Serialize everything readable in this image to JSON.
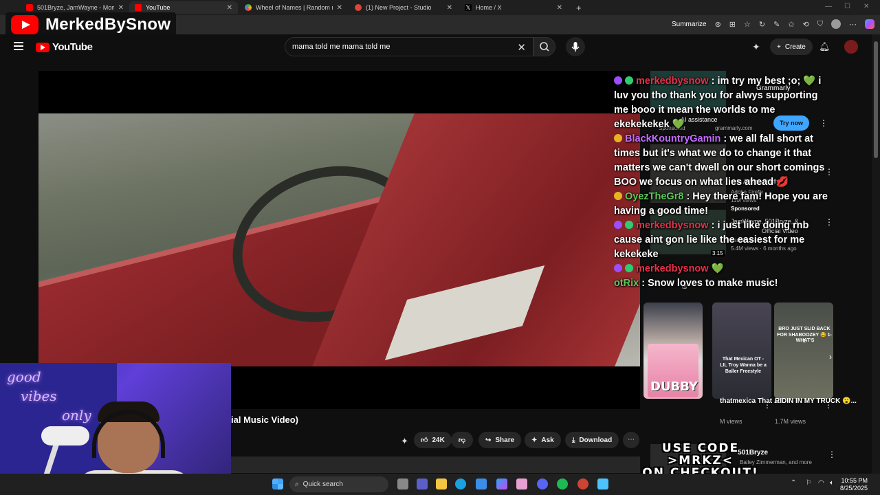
{
  "browser": {
    "tabs": [
      {
        "label": "501Bryze, JamWayne - Mom",
        "icon": "youtube-icon",
        "color": "#ff0000"
      },
      {
        "label": "YouTube",
        "icon": "youtube-icon",
        "color": "#ff0000"
      },
      {
        "label": "Wheel of Names | Random name",
        "icon": "wheel-icon",
        "color": "#34a853"
      },
      {
        "label": "(1) New Project - Studio",
        "icon": "studio-icon",
        "color": "#e0433a"
      },
      {
        "label": "Home / X",
        "icon": "x-icon",
        "color": "#ffffff"
      }
    ],
    "new_tab": "+",
    "summarize_label": "Summarize"
  },
  "overlay": {
    "channel_name": "MerkedBySnow",
    "code_line1": "USE CODE",
    "code_line2": ">MRKZ<",
    "code_line3": "ON CHECKOUT!"
  },
  "youtube": {
    "logo_text": "YouTube",
    "search_value": "mama told me mama told me",
    "create_label": "Create",
    "video_title_partial": "ial Music Video)",
    "actions": {
      "likes": "24K",
      "share": "Share",
      "ask": "Ask",
      "download": "Download"
    }
  },
  "sidebar": {
    "ad1": {
      "title": "Grammarly",
      "sub": "AI assistance",
      "sponsored": "Sponsored",
      "domain": "grammarly.com",
      "cta": "Try now"
    },
    "ad2": {
      "title": "with Adobe Firefly",
      "channel": "Adobe Firefly",
      "views": "11M views",
      "sponsored": "Sponsored"
    },
    "vid3": {
      "title": "JamWayne, 501Bryze, &",
      "channel": "JamWayne",
      "meta": "5.4M views · 6 months ago",
      "duration": "3:15",
      "tag": "Official Video"
    },
    "vid4_meta": "ts",
    "shorts": [
      {
        "title": "That Mexican OT - LIL Troy Wanna be a Baller Freestyle",
        "caption": "thatmexica That ...",
        "views": "M views"
      },
      {
        "title": "RIDIN IN MY TRUCK",
        "caption": "RIDIN IN MY TRUCK 😮...",
        "views": "1.7M views"
      }
    ],
    "shorts_captions": [
      "BRO JUST SLID BACK FOR SHABOOZEY 😂 1-1",
      "WHAT'S"
    ],
    "mix": {
      "title": "- 501Bryze",
      "sub": "Bailey Zimmerman, and more"
    }
  },
  "chat": [
    {
      "user": "merkedbysnow",
      "color": "#e8304a",
      "badges": [
        "mic",
        "check"
      ],
      "text": ": im try my best ;o; 💚 i luv you tho thank you for alwys supporting me booo it mean the worlds to me ekekekekek 💚"
    },
    {
      "user": "BlackKountryGamin",
      "color": "#c46dff",
      "badges": [
        "crown"
      ],
      "text": ": we all fall short at times but it's what we do to change it that matters we can't dwell on our short comings BOO we focus on what lies ahead 💋"
    },
    {
      "user": "OyezTheGr8",
      "color": "#5ac85a",
      "badges": [
        "crown"
      ],
      "text": ": Hey there fam! Hope you are having a good time!"
    },
    {
      "user": "merkedbysnow",
      "color": "#e8304a",
      "badges": [
        "mic",
        "check"
      ],
      "text": ": i just like doing rnb cause aint gon lie like the easiest for me kekekeke"
    },
    {
      "user": "merkedbysnow",
      "color": "#e8304a",
      "badges": [
        "mic",
        "check"
      ],
      "text": " 💚"
    },
    {
      "user": "otRix",
      "color": "#5ac85a",
      "badges": [],
      "text": ": Snow loves to make music!"
    }
  ],
  "webcam": {
    "neon_text_1": "good",
    "neon_text_2": "vibes",
    "neon_text_3": "only"
  },
  "taskbar": {
    "search_label": "Quick search",
    "time": "10:55 PM",
    "date": "8/25/2025"
  },
  "colors": {
    "accent": "#3ea6ff",
    "youtube_red": "#ff0000",
    "chip": "#272727"
  }
}
